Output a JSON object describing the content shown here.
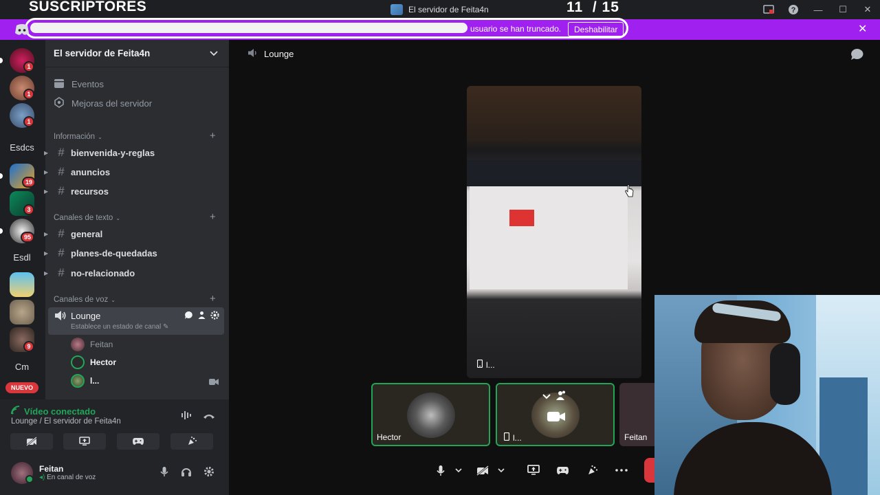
{
  "overlay": {
    "subscribers_label": "SUSCRIPTORES",
    "counter": "11  / 15"
  },
  "window": {
    "title": "El servidor de Feita4n"
  },
  "banner": {
    "text": "usuario se han truncado.",
    "button": "Deshabilitar",
    "close": "✕",
    "color": "#a020f0"
  },
  "rail": {
    "folders": [
      "Esdcs",
      "Esdl",
      "Cm"
    ],
    "badges": [
      "1",
      "1",
      "1",
      "19",
      "3",
      "95",
      "9"
    ],
    "new_label": "NUEVO"
  },
  "server": {
    "name": "El servidor de Feita4n",
    "events": "Eventos",
    "boosts": "Mejoras del servidor",
    "categories": {
      "info": "Información",
      "text": "Canales de texto",
      "voice": "Canales de voz"
    },
    "info_channels": [
      "bienvenida-y-reglas",
      "anuncios",
      "recursos"
    ],
    "text_channels": [
      "general",
      "planes-de-quedadas",
      "no-relacionado"
    ],
    "voice_channel": {
      "name": "Lounge",
      "status": "Establece un estado de canal",
      "members": [
        "Feitan",
        "Hector",
        "l..."
      ]
    }
  },
  "voice_panel": {
    "status": "Vídeo conectado",
    "location": "Lounge / El servidor de Feita4n"
  },
  "user": {
    "name": "Feitan",
    "status": "En canal de voz"
  },
  "main": {
    "channel": "Lounge",
    "stream_label": "l...",
    "tiles": [
      "Hector",
      "l...",
      "Feitan"
    ]
  },
  "colors": {
    "accent_green": "#23a559",
    "badge_red": "#da373c"
  }
}
